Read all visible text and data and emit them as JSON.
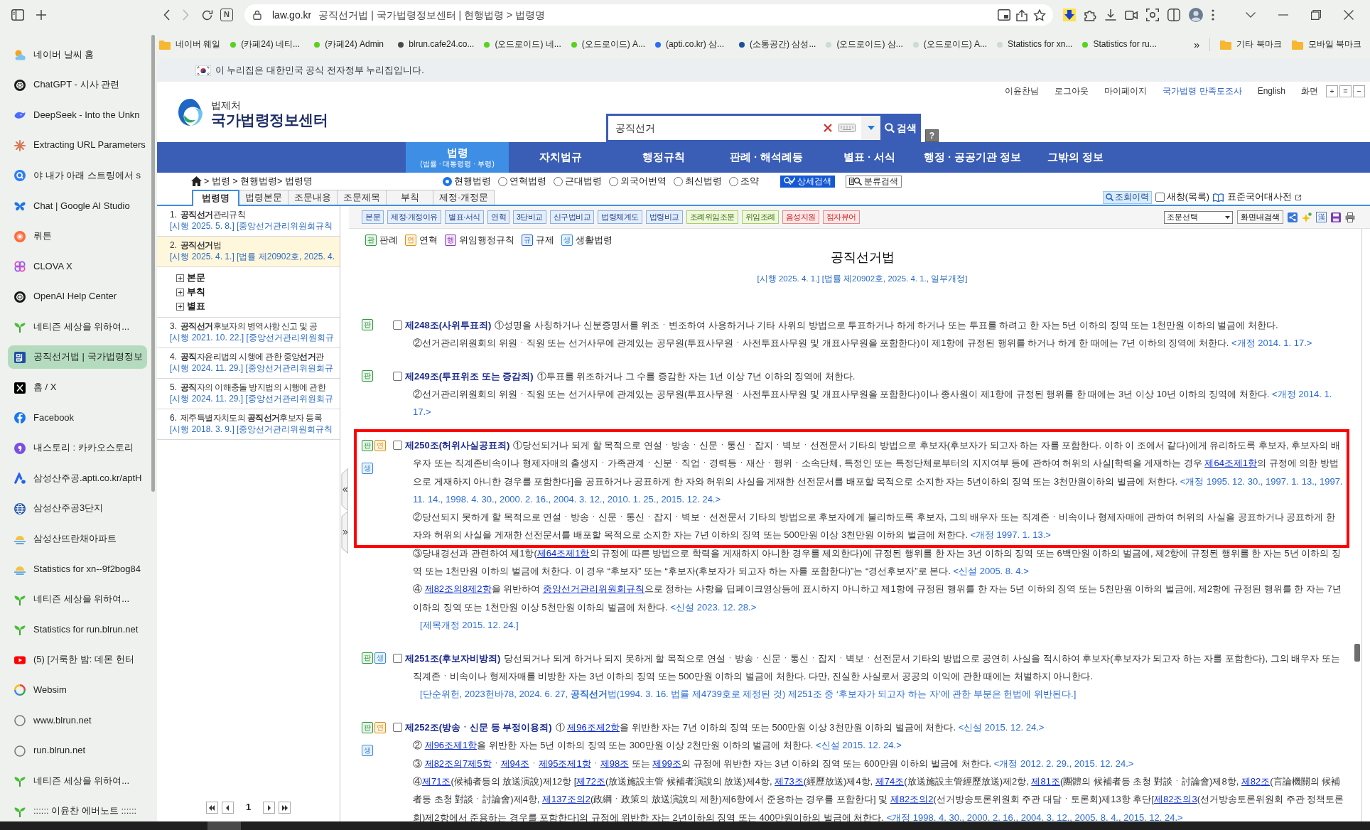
{
  "browser": {
    "reader_button": "N",
    "forward_disabled": true,
    "address": {
      "host": "law.go.kr",
      "title": "공직선거법 | 국가법령정보센터 | 현행법령 > 법령명"
    },
    "bookmarks": [
      {
        "label": "네이버 웨일",
        "kind": "folder"
      },
      {
        "label": "(카페24) 네티...",
        "kind": "dot",
        "color": "#5ad11e"
      },
      {
        "label": "(카페24) Admin",
        "kind": "dot",
        "color": "#5ad11e"
      },
      {
        "label": "blrun.cafe24.co...",
        "kind": "dot",
        "color": "#4a4a4a"
      },
      {
        "label": "(오드로이드) 네...",
        "kind": "dot",
        "color": "#5ad11e"
      },
      {
        "label": "(오드로이드) A...",
        "kind": "dot",
        "color": "#5ad11e"
      },
      {
        "label": "(apti.co.kr) 삼...",
        "kind": "dot",
        "color": "#2f6df0"
      },
      {
        "label": "(소통공간) 삼성...",
        "kind": "dot",
        "color": "#1d4f9c"
      },
      {
        "label": "(오드로이드) 삼...",
        "kind": "dot",
        "color": "#cfdad2"
      },
      {
        "label": "(오드로이드) A...",
        "kind": "dot",
        "color": "#cfdad2"
      },
      {
        "label": "Statistics for xn...",
        "kind": "dot",
        "color": "#cfdad2"
      },
      {
        "label": "Statistics for ru...",
        "kind": "dot",
        "color": "#5ad11e"
      }
    ],
    "bookmarks_more": "»",
    "bookmark_folders": [
      "기타 북마크",
      "모바일 북마크"
    ],
    "tabs": [
      {
        "label": "네이버 날씨 홈",
        "kind": "weather",
        "selected": false
      },
      {
        "label": "ChatGPT - 시사 관련",
        "kind": "knot",
        "selected": false
      },
      {
        "label": "DeepSeek - Into the Unkn",
        "kind": "whale",
        "selected": false
      },
      {
        "label": "Extracting URL Parameters",
        "kind": "burst",
        "selected": false
      },
      {
        "label": "야 내가 아래 스트링에서 s",
        "kind": "q",
        "selected": false
      },
      {
        "label": "Chat | Google AI Studio",
        "kind": "butterfly",
        "selected": false
      },
      {
        "label": "뤼튼",
        "kind": "ai",
        "selected": false
      },
      {
        "label": "CLOVA X",
        "kind": "clover",
        "selected": false
      },
      {
        "label": "OpenAI Help Center",
        "kind": "knot",
        "selected": false
      },
      {
        "label": "네티즌 세상을 위하여...",
        "kind": "sprout",
        "selected": false
      },
      {
        "label": "공직선거법 | 국가법령정보",
        "kind": "law",
        "selected": true
      },
      {
        "label": "홈 / X",
        "kind": "x",
        "selected": false
      },
      {
        "label": "Facebook",
        "kind": "facebook",
        "selected": false
      },
      {
        "label": "내스토리 : 카카오스토리",
        "kind": "story",
        "selected": false
      },
      {
        "label": "삼성산주공.apti.co.kr/aptH",
        "kind": "apti",
        "selected": false
      },
      {
        "label": "삼성산주공3단지",
        "kind": "globe",
        "selected": false
      },
      {
        "label": "삼성산뜨란채아파트",
        "kind": "sunrise",
        "selected": false
      },
      {
        "label": "Statistics for xn--9f2bog84",
        "kind": "sunrise",
        "selected": false
      },
      {
        "label": "네티즌 세상을 위하여...",
        "kind": "sprout",
        "selected": false
      },
      {
        "label": "Statistics for run.blrun.net",
        "kind": "sprout",
        "selected": false
      },
      {
        "label": "(5) [거룩한 밤: 데몬 헌터",
        "kind": "play",
        "selected": false
      },
      {
        "label": "Websim",
        "kind": "swirl",
        "selected": false
      },
      {
        "label": "www.blrun.net",
        "kind": "ring",
        "selected": false
      },
      {
        "label": "run.blrun.net",
        "kind": "ring",
        "selected": false
      },
      {
        "label": "네티즌 세상을 위하여...",
        "kind": "sprout",
        "selected": false
      },
      {
        "label": ":::::: 이윤찬 에버노트 ::::::",
        "kind": "sprout",
        "selected": false
      }
    ]
  },
  "gov_banner": "이 누리집은 대한민국 공식 전자정부 누리집입니다.",
  "header": {
    "org": "법제처",
    "site": "국가법령정보센터",
    "search": {
      "value": "공직선거",
      "button": "검색",
      "help": "?"
    },
    "user_links": [
      {
        "label": "이윤찬님",
        "kind": "text"
      },
      {
        "label": "로그아웃",
        "kind": "link"
      },
      {
        "label": "마이페이지",
        "kind": "link"
      },
      {
        "label": "국가법령 만족도조사",
        "kind": "survey"
      },
      {
        "label": "English",
        "kind": "link"
      }
    ],
    "zoom_label": "화면",
    "zoom_buttons": [
      "+",
      "=",
      "−"
    ]
  },
  "nav": [
    {
      "label": "법령",
      "sub": "(법률 · 대통령령 · 부령)",
      "selected": true
    },
    {
      "label": "자치법규",
      "selected": false
    },
    {
      "label": "행정규칙",
      "selected": false
    },
    {
      "label": "판례 · 해석례등",
      "selected": false
    },
    {
      "label": "별표 · 서식",
      "selected": false
    },
    {
      "label": "행정 · 공공기관 정보",
      "selected": false
    },
    {
      "label": "그밖의 정보",
      "selected": false
    }
  ],
  "search_bar": {
    "breadcrumb": "> 법령 > 현행법령> 법령명",
    "scopes": [
      {
        "label": "현행법령",
        "selected": true
      },
      {
        "label": "연혁법령",
        "selected": false
      },
      {
        "label": "근대법령",
        "selected": false
      },
      {
        "label": "외국어번역",
        "selected": false
      },
      {
        "label": "최신법령",
        "selected": false
      },
      {
        "label": "조약",
        "selected": false
      }
    ],
    "buttons": [
      {
        "label": "상세검색",
        "kind": "primary"
      },
      {
        "label": "분류검색",
        "kind": "outline"
      }
    ]
  },
  "result_tabs": [
    {
      "label": "법령명",
      "selected": true
    },
    {
      "label": "법령본문",
      "selected": false
    },
    {
      "label": "조문내용",
      "selected": false
    },
    {
      "label": "조문제목",
      "selected": false
    },
    {
      "label": "부칙",
      "selected": false
    },
    {
      "label": "제정·개정문",
      "selected": false
    }
  ],
  "side_tools": {
    "history": "조회이력",
    "new_window": {
      "label": "새창(목록)",
      "checked": false
    },
    "dictionary": "표준국어대사전"
  },
  "results": [
    {
      "number": "1.",
      "title": "**공직선거**관리규칙",
      "meta": "[시행 2025. 5. 8.] [중앙선거관리위원회규칙",
      "selected": false
    },
    {
      "number": "2.",
      "title": "**공직선거**법",
      "meta": "[시행 2025. 4. 1.] [법률 제20902호, 2025. 4.",
      "selected": true,
      "children": [
        {
          "label": "본문",
          "expanded": false
        },
        {
          "label": "부칙",
          "expanded": false
        },
        {
          "label": "별표",
          "expanded": false
        }
      ]
    },
    {
      "number": "3.",
      "title": "**공직선거**후보자의 병역사항 신고 및 공",
      "meta": "[시행 2021. 10. 22.] [중앙선거관리위원회규",
      "selected": false
    },
    {
      "number": "4.",
      "title": "**공직**자윤리법의 시행에 관한 중앙**선거**관",
      "meta": "[시행 2024. 11. 29.] [중앙선거관리위원회규",
      "selected": false
    },
    {
      "number": "5.",
      "title": "**공직**자의 이해충돌 방지법의 시행에 관한",
      "meta": "[시행 2024. 11. 29.] [중앙선거관리위원회규",
      "selected": false
    },
    {
      "number": "6.",
      "title": "제주특별자치도의 **공직선거**후보자 등록",
      "meta": "[시행 2018. 3. 9.] [중앙선거관리위원회규칙",
      "selected": false
    }
  ],
  "pager": {
    "page": "1"
  },
  "law_toolbar": {
    "buttons": [
      {
        "label": "본문",
        "kind": "law"
      },
      {
        "label": "제정·개정이유",
        "kind": "law"
      },
      {
        "label": "별표·서식",
        "kind": "law"
      },
      {
        "label": "연혁",
        "kind": "law"
      },
      {
        "label": "3단비교",
        "kind": "law"
      },
      {
        "label": "신구법비교",
        "kind": "law"
      },
      {
        "label": "법령체계도",
        "kind": "law"
      },
      {
        "label": "법령비교",
        "kind": "law"
      },
      {
        "label": "조례위임조문",
        "kind": "ordinance"
      },
      {
        "label": "위임조례",
        "kind": "ordinance"
      },
      {
        "label": "음성지원",
        "kind": "access"
      },
      {
        "label": "점자뷰어",
        "kind": "access"
      }
    ],
    "select": "조문선택",
    "find": "화면내검색",
    "hanja": "漢"
  },
  "legend": [
    {
      "badge": "판",
      "label": "판례",
      "color": "#2f9a3c"
    },
    {
      "badge": "연",
      "label": "연혁",
      "color": "#e0900b"
    },
    {
      "badge": "행",
      "label": "위임행정규칙",
      "color": "#8a3ab9"
    },
    {
      "badge": "규",
      "label": "규제",
      "color": "#2466d0"
    },
    {
      "badge": "생",
      "label": "생활법령",
      "color": "#3a8ad6"
    }
  ],
  "law": {
    "title": "공직선거법",
    "subtitle": "[시행 2025. 4. 1.] [법률 제20902호, 2025. 4. 1., 일부개정]",
    "articles": [
      {
        "badges": [
          {
            "text": "판",
            "color": "#2f9a3c"
          }
        ],
        "checked": false,
        "heading": "제248조(사위투표죄)",
        "paragraphs": [
          {
            "highlighted": false,
            "parts": [
              {
                "kind": "text",
                "text": "①성명을 사칭하거나 신분증명서를 위조ㆍ변조하여 사용하거나 기타 사위의 방법으로 투표하거나 하게 하거나 또는 투표를 하려고 한 자는 5년 이하의 징역 또는 1천만원 이하의 벌금에 처한다."
              }
            ]
          },
          {
            "highlighted": false,
            "parts": [
              {
                "kind": "text",
                "text": "②선거관리위원회의 위원ㆍ직원 또는 선거사무에 관계있는 공무원(투표사무원ㆍ사전투표사무원 및 개표사무원을 포함한다)이 제1항에 규정된 행위를 하거나 하게 한 때에는 7년 이하의 징역에 처한다. "
              },
              {
                "kind": "note",
                "text": "<개정 2014. 1. 17.>"
              }
            ]
          }
        ]
      },
      {
        "badges": [
          {
            "text": "판",
            "color": "#2f9a3c"
          }
        ],
        "checked": false,
        "heading": "제249조(투표위조 또는 증감죄)",
        "paragraphs": [
          {
            "highlighted": false,
            "parts": [
              {
                "kind": "text",
                "text": "①투표를 위조하거나 그 수를 증감한 자는 1년 이상 7년 이하의 징역에 처한다."
              }
            ]
          },
          {
            "highlighted": false,
            "parts": [
              {
                "kind": "text",
                "text": "②선거관리위원회의 위원ㆍ직원 또는 선거사무에 관계있는 공무원(투표사무원ㆍ사전투표사무원 및 개표사무원을 포함한다)이나 종사원이 제1항에 규정된 행위를 한 때에는 3년 이상 10년 이하의 징역에 처한다. "
              },
              {
                "kind": "note",
                "text": "<개정 2014. 1. 17.>"
              }
            ]
          }
        ]
      },
      {
        "badges": [
          {
            "text": "판",
            "color": "#2f9a3c"
          },
          {
            "text": "연",
            "color": "#e0900b"
          },
          {
            "text": "생",
            "color": "#3a8ad6"
          }
        ],
        "checked": false,
        "heading": "제250조(허위사실공표죄)",
        "paragraphs": [
          {
            "highlighted": true,
            "parts": [
              {
                "kind": "text",
                "text": "①당선되거나 되게 할 목적으로 연설ㆍ방송ㆍ신문ㆍ통신ㆍ잡지ㆍ벽보ㆍ선전문서 기타의 방법으로 후보자(후보자가 되고자 하는 자를 포함한다. 이하 이 조에서 같다)에게 유리하도록 후보자, 후보자의 배우자 또는 직계존비속이나 형제자매의 출생지ㆍ가족관계ㆍ신분ㆍ직업ㆍ경력등ㆍ재산ㆍ행위ㆍ소속단체, 특정인 또는 특정단체로부터의 지지여부 등에 관하여 허위의 사실[학력을 게재하는 경우 "
              },
              {
                "kind": "link",
                "text": "제64조제1항"
              },
              {
                "kind": "text",
                "text": "의 규정에 의한 방법으로 게재하지 아니한 경우를 포함한다]을 공표하거나 공표하게 한 자와 허위의 사실을 게재한 선전문서를 배포할 목적으로 소지한 자는 5년이하의 징역 또는 3천만원이하의 벌금에 처한다. "
              },
              {
                "kind": "note",
                "text": "<개정 1995. 12. 30., 1997. 1. 13., 1997. 11. 14., 1998. 4. 30., 2000. 2. 16., 2004. 3. 12., 2010. 1. 25., 2015. 12. 24.>"
              }
            ]
          },
          {
            "highlighted": true,
            "parts": [
              {
                "kind": "text",
                "text": "②당선되지 못하게 할 목적으로 연설ㆍ방송ㆍ신문ㆍ통신ㆍ잡지ㆍ벽보ㆍ선전문서 기타의 방법으로 후보자에게 불리하도록 후보자, 그의 배우자 또는 직계존ㆍ비속이나 형제자매에 관하여 허위의 사실을 공표하거나 공표하게 한 자와 허위의 사실을 게재한 선전문서를 배포할 목적으로 소지한 자는 7년 이하의 징역 또는 500만원 이상 3천만원 이하의 벌금에 처한다. "
              },
              {
                "kind": "note",
                "text": "<개정 1997. 1. 13.>"
              }
            ]
          },
          {
            "highlighted": false,
            "parts": [
              {
                "kind": "text",
                "text": "③당내경선과 관련하여 제1항("
              },
              {
                "kind": "link",
                "text": "제64조제1항"
              },
              {
                "kind": "text",
                "text": "의 규정에 따른 방법으로 학력을 게재하지 아니한 경우를 제외한다)에 규정된 행위를 한 자는 3년 이하의 징역 또는 6백만원 이하의 벌금에, 제2항에 규정된 행위를 한 자는 5년 이하의 징역 또는 1천만원 이하의 벌금에 처한다. 이 경우 “후보자” 또는 “후보자(후보자가 되고자 하는 자를 포함한다)”는 “경선후보자”로 본다. "
              },
              {
                "kind": "note",
                "text": "<신설 2005. 8. 4.>"
              }
            ]
          },
          {
            "highlighted": false,
            "parts": [
              {
                "kind": "text",
                "text": "④ "
              },
              {
                "kind": "link",
                "text": "제82조의8제2항"
              },
              {
                "kind": "text",
                "text": "을 위반하여 "
              },
              {
                "kind": "link",
                "text": "중앙선거관리위원회규칙"
              },
              {
                "kind": "text",
                "text": "으로 정하는 사항을 딥페이크영상등에 표시하지 아니하고 제1항에 규정된 행위를 한 자는 5년 이하의 징역 또는 5천만원 이하의 벌금에, 제2항에 규정된 행위를 한 자는 7년 이하의 징역 또는 1천만원 이상 5천만원 이하의 벌금에 처한다. "
              },
              {
                "kind": "note",
                "text": "<신설 2023. 12. 28.>"
              }
            ]
          }
        ],
        "footnote": "[제목개정 2015. 12. 24.]"
      },
      {
        "badges": [
          {
            "text": "판",
            "color": "#2f9a3c"
          },
          {
            "text": "생",
            "color": "#3a8ad6"
          }
        ],
        "checked": false,
        "heading": "제251조(후보자비방죄)",
        "paragraphs": [
          {
            "highlighted": false,
            "parts": [
              {
                "kind": "text",
                "text": "당선되거나 되게 하거나 되지 못하게 할 목적으로 연설ㆍ방송ㆍ신문ㆍ통신ㆍ잡지ㆍ벽보ㆍ선전문서 기타의 방법으로 공연히 사실을 적시하여 후보자(후보자가 되고자 하는 자를 포함한다), 그의 배우자 또는 직계존ㆍ비속이나 형제자매를 비방한 자는 3년 이하의 징역 또는 500만원 이하의 벌금에 처한다. 다만, 진실한 사실로서 공공의 이익에 관한 때에는 처벌하지 아니한다."
              }
            ]
          }
        ],
        "footnote": "[단순위헌, 2023헌바78, 2024. 6. 27, **공직선거**법(1994. 3. 16. 법률 제4739호로 제정된 것) 제251조 중 ‘후보자가 되고자 하는 자’에 관한 부분은 헌법에 위반된다.]"
      },
      {
        "badges": [
          {
            "text": "판",
            "color": "#2f9a3c"
          },
          {
            "text": "연",
            "color": "#e0900b"
          },
          {
            "text": "생",
            "color": "#3a8ad6"
          }
        ],
        "checked": false,
        "heading": "제252조(방송ㆍ신문 등 부정이용죄)",
        "paragraphs": [
          {
            "highlighted": false,
            "parts": [
              {
                "kind": "text",
                "text": "① "
              },
              {
                "kind": "link",
                "text": "제96조제2항"
              },
              {
                "kind": "text",
                "text": "을 위반한 자는 7년 이하의 징역 또는 500만원 이상 3천만원 이하의 벌금에 처한다. "
              },
              {
                "kind": "note",
                "text": "<신설 2015. 12. 24.>"
              }
            ]
          },
          {
            "highlighted": false,
            "parts": [
              {
                "kind": "text",
                "text": "② "
              },
              {
                "kind": "link",
                "text": "제96조제1항"
              },
              {
                "kind": "text",
                "text": "을 위반한 자는 5년 이하의 징역 또는 300만원 이상 2천만원 이하의 벌금에 처한다. "
              },
              {
                "kind": "note",
                "text": "<신설 2015. 12. 24.>"
              }
            ]
          },
          {
            "highlighted": false,
            "parts": [
              {
                "kind": "text",
                "text": "③ "
              },
              {
                "kind": "link",
                "text": "제82조의7제5항"
              },
              {
                "kind": "text",
                "text": "ㆍ"
              },
              {
                "kind": "link",
                "text": "제94조"
              },
              {
                "kind": "text",
                "text": "ㆍ"
              },
              {
                "kind": "link",
                "text": "제95조제1항"
              },
              {
                "kind": "text",
                "text": "ㆍ"
              },
              {
                "kind": "link",
                "text": "제98조"
              },
              {
                "kind": "text",
                "text": " 또는 "
              },
              {
                "kind": "link",
                "text": "제99조"
              },
              {
                "kind": "text",
                "text": "의 규정에 위반한 자는 3년 이하의 징역 또는 600만원 이하의 벌금에 처한다. "
              },
              {
                "kind": "note",
                "text": "<개정 2012. 2. 29., 2015. 12. 24.>"
              }
            ]
          },
          {
            "highlighted": false,
            "parts": [
              {
                "kind": "text",
                "text": "④"
              },
              {
                "kind": "link",
                "text": "제71조"
              },
              {
                "kind": "text",
                "text": "(候補者등의 放送演說)제12항 ["
              },
              {
                "kind": "link",
                "text": "제72조"
              },
              {
                "kind": "text",
                "text": "(放送施設主管 候補者演說의 放送)제4항, "
              },
              {
                "kind": "link",
                "text": "제73조"
              },
              {
                "kind": "text",
                "text": "(經歷放送)제4항, "
              },
              {
                "kind": "link",
                "text": "제74조"
              },
              {
                "kind": "text",
                "text": "(放送施設主管經歷放送)제2항, "
              },
              {
                "kind": "link",
                "text": "제81조"
              },
              {
                "kind": "text",
                "text": "(團體의 候補者등 초청 對談ㆍ討論會)제8항, "
              },
              {
                "kind": "link",
                "text": "제82조"
              },
              {
                "kind": "text",
                "text": "(言論機關의 候補者등 초청 對談ㆍ討論會)제4항, "
              },
              {
                "kind": "link",
                "text": "제137조의2"
              },
              {
                "kind": "text",
                "text": "(政綱ㆍ政策의 放送演說의 제한)제6항에서 준용하는 경우를 포함한다] 및 "
              },
              {
                "kind": "link",
                "text": "제82조의2"
              },
              {
                "kind": "text",
                "text": "(선거방송토론위원회 주관 대담ㆍ토론회)제13항 후단["
              },
              {
                "kind": "link",
                "text": "제82조의3"
              },
              {
                "kind": "text",
                "text": "(선거방송토론위원회 주관 정책토론회)제2항에서 준용하는 경우를 포함한다]의 규정에 위반한 자는 2년이하의 징역 또는 400만원이하의 벌금에 처한다. "
              },
              {
                "kind": "note",
                "text": "<개정 1998. 4. 30., 2000. 2. 16., 2004. 3. 12., 2005. 8. 4., 2015. 12. 24.>"
              }
            ]
          }
        ]
      }
    ]
  }
}
